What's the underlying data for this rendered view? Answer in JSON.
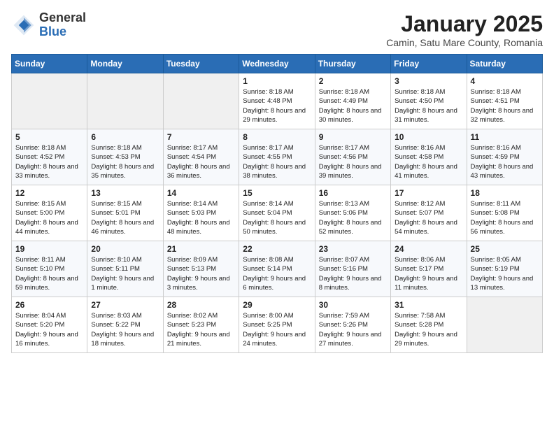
{
  "header": {
    "logo_line1": "General",
    "logo_line2": "Blue",
    "title": "January 2025",
    "subtitle": "Camin, Satu Mare County, Romania"
  },
  "days_of_week": [
    "Sunday",
    "Monday",
    "Tuesday",
    "Wednesday",
    "Thursday",
    "Friday",
    "Saturday"
  ],
  "weeks": [
    [
      {
        "day": "",
        "empty": true
      },
      {
        "day": "",
        "empty": true
      },
      {
        "day": "",
        "empty": true
      },
      {
        "day": "1",
        "sunrise": "8:18 AM",
        "sunset": "4:48 PM",
        "daylight": "8 hours and 29 minutes."
      },
      {
        "day": "2",
        "sunrise": "8:18 AM",
        "sunset": "4:49 PM",
        "daylight": "8 hours and 30 minutes."
      },
      {
        "day": "3",
        "sunrise": "8:18 AM",
        "sunset": "4:50 PM",
        "daylight": "8 hours and 31 minutes."
      },
      {
        "day": "4",
        "sunrise": "8:18 AM",
        "sunset": "4:51 PM",
        "daylight": "8 hours and 32 minutes."
      }
    ],
    [
      {
        "day": "5",
        "sunrise": "8:18 AM",
        "sunset": "4:52 PM",
        "daylight": "8 hours and 33 minutes."
      },
      {
        "day": "6",
        "sunrise": "8:18 AM",
        "sunset": "4:53 PM",
        "daylight": "8 hours and 35 minutes."
      },
      {
        "day": "7",
        "sunrise": "8:17 AM",
        "sunset": "4:54 PM",
        "daylight": "8 hours and 36 minutes."
      },
      {
        "day": "8",
        "sunrise": "8:17 AM",
        "sunset": "4:55 PM",
        "daylight": "8 hours and 38 minutes."
      },
      {
        "day": "9",
        "sunrise": "8:17 AM",
        "sunset": "4:56 PM",
        "daylight": "8 hours and 39 minutes."
      },
      {
        "day": "10",
        "sunrise": "8:16 AM",
        "sunset": "4:58 PM",
        "daylight": "8 hours and 41 minutes."
      },
      {
        "day": "11",
        "sunrise": "8:16 AM",
        "sunset": "4:59 PM",
        "daylight": "8 hours and 43 minutes."
      }
    ],
    [
      {
        "day": "12",
        "sunrise": "8:15 AM",
        "sunset": "5:00 PM",
        "daylight": "8 hours and 44 minutes."
      },
      {
        "day": "13",
        "sunrise": "8:15 AM",
        "sunset": "5:01 PM",
        "daylight": "8 hours and 46 minutes."
      },
      {
        "day": "14",
        "sunrise": "8:14 AM",
        "sunset": "5:03 PM",
        "daylight": "8 hours and 48 minutes."
      },
      {
        "day": "15",
        "sunrise": "8:14 AM",
        "sunset": "5:04 PM",
        "daylight": "8 hours and 50 minutes."
      },
      {
        "day": "16",
        "sunrise": "8:13 AM",
        "sunset": "5:06 PM",
        "daylight": "8 hours and 52 minutes."
      },
      {
        "day": "17",
        "sunrise": "8:12 AM",
        "sunset": "5:07 PM",
        "daylight": "8 hours and 54 minutes."
      },
      {
        "day": "18",
        "sunrise": "8:11 AM",
        "sunset": "5:08 PM",
        "daylight": "8 hours and 56 minutes."
      }
    ],
    [
      {
        "day": "19",
        "sunrise": "8:11 AM",
        "sunset": "5:10 PM",
        "daylight": "8 hours and 59 minutes."
      },
      {
        "day": "20",
        "sunrise": "8:10 AM",
        "sunset": "5:11 PM",
        "daylight": "9 hours and 1 minute."
      },
      {
        "day": "21",
        "sunrise": "8:09 AM",
        "sunset": "5:13 PM",
        "daylight": "9 hours and 3 minutes."
      },
      {
        "day": "22",
        "sunrise": "8:08 AM",
        "sunset": "5:14 PM",
        "daylight": "9 hours and 6 minutes."
      },
      {
        "day": "23",
        "sunrise": "8:07 AM",
        "sunset": "5:16 PM",
        "daylight": "9 hours and 8 minutes."
      },
      {
        "day": "24",
        "sunrise": "8:06 AM",
        "sunset": "5:17 PM",
        "daylight": "9 hours and 11 minutes."
      },
      {
        "day": "25",
        "sunrise": "8:05 AM",
        "sunset": "5:19 PM",
        "daylight": "9 hours and 13 minutes."
      }
    ],
    [
      {
        "day": "26",
        "sunrise": "8:04 AM",
        "sunset": "5:20 PM",
        "daylight": "9 hours and 16 minutes."
      },
      {
        "day": "27",
        "sunrise": "8:03 AM",
        "sunset": "5:22 PM",
        "daylight": "9 hours and 18 minutes."
      },
      {
        "day": "28",
        "sunrise": "8:02 AM",
        "sunset": "5:23 PM",
        "daylight": "9 hours and 21 minutes."
      },
      {
        "day": "29",
        "sunrise": "8:00 AM",
        "sunset": "5:25 PM",
        "daylight": "9 hours and 24 minutes."
      },
      {
        "day": "30",
        "sunrise": "7:59 AM",
        "sunset": "5:26 PM",
        "daylight": "9 hours and 27 minutes."
      },
      {
        "day": "31",
        "sunrise": "7:58 AM",
        "sunset": "5:28 PM",
        "daylight": "9 hours and 29 minutes."
      },
      {
        "day": "",
        "empty": true
      }
    ]
  ],
  "labels": {
    "sunrise": "Sunrise:",
    "sunset": "Sunset:",
    "daylight": "Daylight hours"
  }
}
